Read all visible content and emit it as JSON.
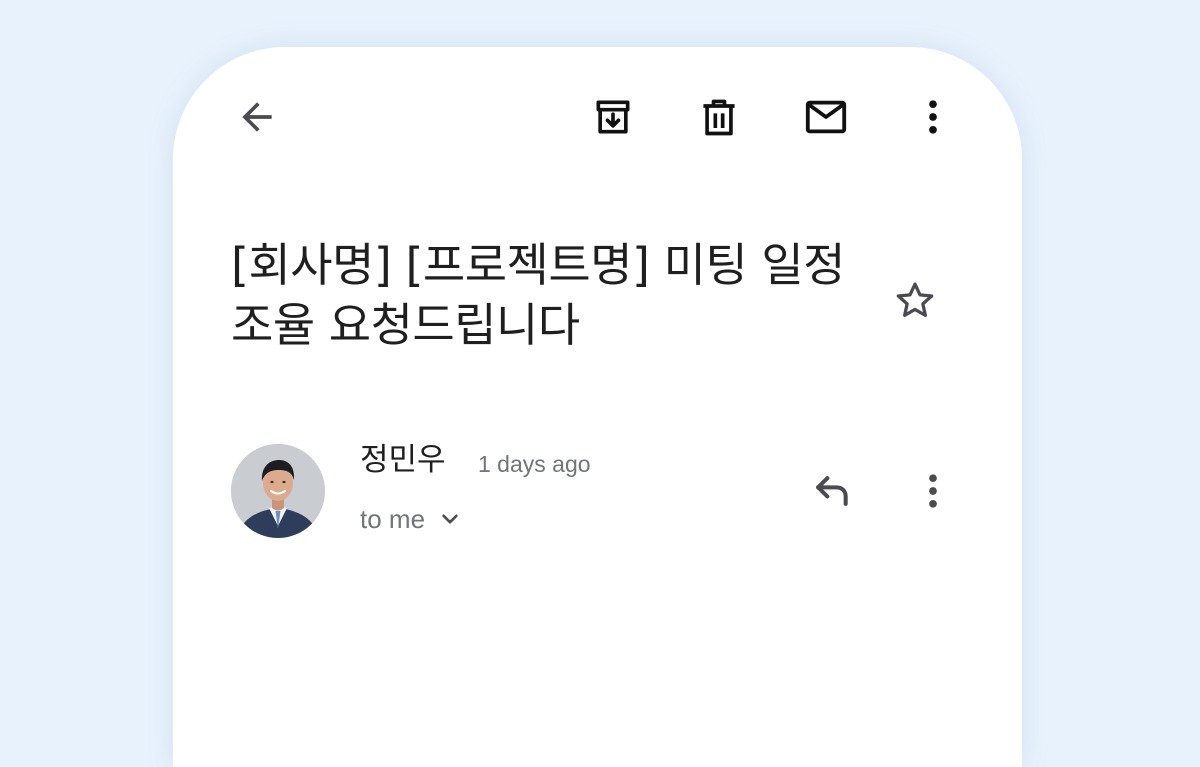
{
  "email": {
    "subject": "[회사명] [프로젝트명] 미팅 일정 조율 요청드립니다",
    "sender": {
      "name": "정민우",
      "time": "1 days ago",
      "recipient_label": "to me"
    }
  },
  "toolbar": {
    "icons": [
      "arrow-left-icon",
      "archive-icon",
      "trash-icon",
      "mail-icon",
      "more-vert-icon"
    ]
  },
  "colors": {
    "background": "#e8f2fd",
    "card": "#ffffff",
    "icon": "#4a4a50",
    "text_primary": "#1f1f1f",
    "text_secondary": "#71747a"
  }
}
